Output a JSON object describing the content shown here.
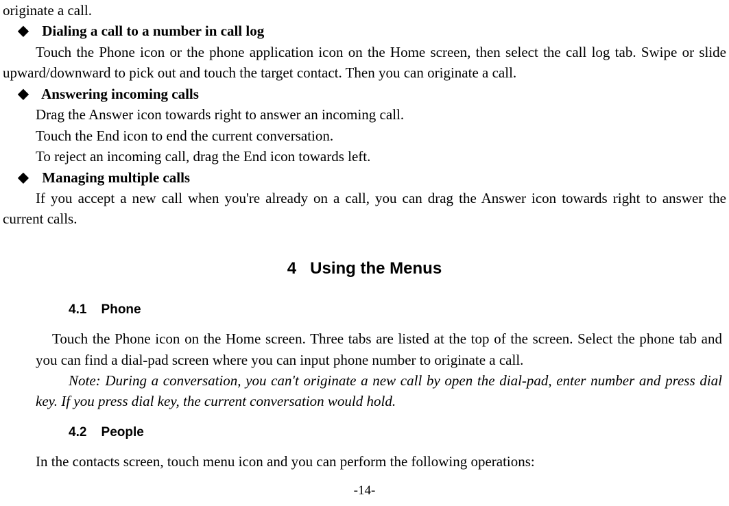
{
  "fragment_top": "originate a call.",
  "bullets": {
    "dialing": {
      "heading": "Dialing a call to a number in call log",
      "body": "Touch the Phone icon or the phone application icon on the Home screen, then select the call log tab. Swipe or slide upward/downward to pick out and touch the target contact. Then you can originate a call."
    },
    "answering": {
      "heading": "Answering incoming calls",
      "line1": "Drag the Answer icon towards right to answer an incoming call.",
      "line2": "Touch the End icon to end the current conversation.",
      "line3": "To reject an incoming call, drag the End icon towards left."
    },
    "multiple": {
      "heading": "Managing multiple calls",
      "body": "If you accept a new call when you're already on a call, you can drag the Answer icon towards right to answer the current calls."
    }
  },
  "chapter": {
    "number": "4",
    "title": "Using the Menus"
  },
  "sections": {
    "phone": {
      "number": "4.1",
      "title": "Phone",
      "body": "Touch the Phone icon on the Home screen. Three tabs are listed at the top of the screen. Select the phone tab and you can find a dial-pad screen where you can input phone number to originate a call.",
      "note": "Note: During a conversation, you can't originate a new call by open the dial-pad, enter number and press dial key. If you press dial key, the current conversation would hold."
    },
    "people": {
      "number": "4.2",
      "title": "People",
      "body": "In the contacts screen, touch menu icon and you can perform the following operations:"
    }
  },
  "page_number": "-14-"
}
